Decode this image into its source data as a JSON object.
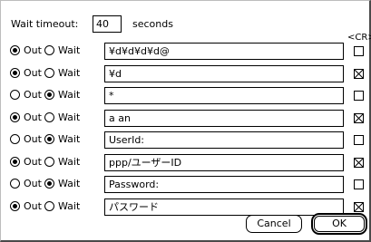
{
  "timeout": {
    "label": "Wait timeout:",
    "value": "40",
    "unit": "seconds"
  },
  "cr_header": "<CR>",
  "rows": [
    {
      "mode": "Out",
      "out_label": "Out",
      "wait_label": "Wait",
      "text": "¥d¥d¥d¥d@",
      "cr": false
    },
    {
      "mode": "Out",
      "out_label": "Out",
      "wait_label": "Wait",
      "text": "¥d",
      "cr": true
    },
    {
      "mode": "Wait",
      "out_label": "Out",
      "wait_label": "Wait",
      "text": "*",
      "cr": false
    },
    {
      "mode": "Out",
      "out_label": "Out",
      "wait_label": "Wait",
      "text": "a an",
      "cr": true
    },
    {
      "mode": "Wait",
      "out_label": "Out",
      "wait_label": "Wait",
      "text": "UserId:",
      "cr": false
    },
    {
      "mode": "Out",
      "out_label": "Out",
      "wait_label": "Wait",
      "text": "ppp/ユーザーID",
      "cr": true
    },
    {
      "mode": "Wait",
      "out_label": "Out",
      "wait_label": "Wait",
      "text": "Password:",
      "cr": false
    },
    {
      "mode": "Out",
      "out_label": "Out",
      "wait_label": "Wait",
      "text": "パスワード",
      "cr": true
    }
  ],
  "buttons": {
    "cancel": "Cancel",
    "ok": "OK"
  }
}
